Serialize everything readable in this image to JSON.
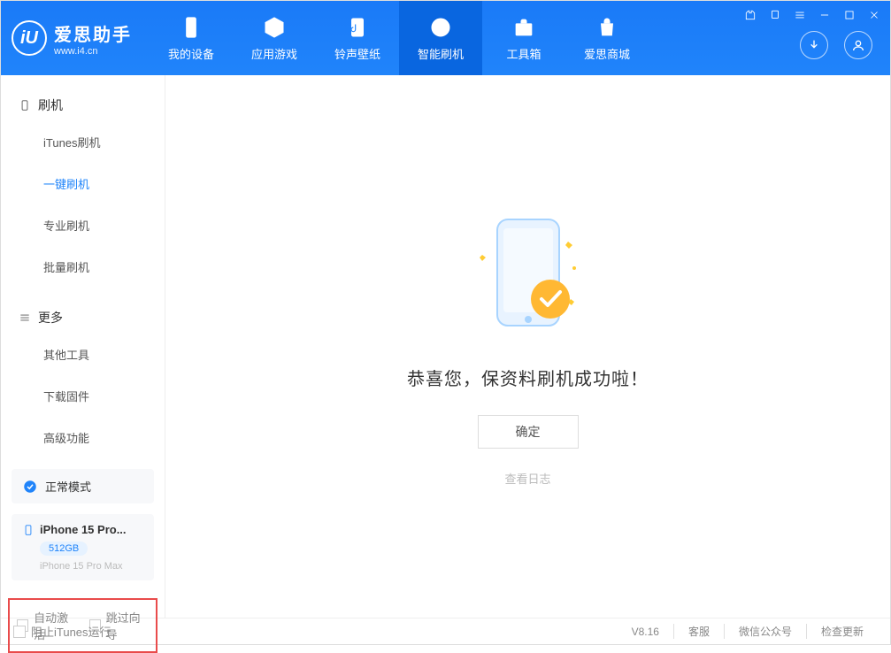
{
  "app": {
    "title": "爱思助手",
    "url": "www.i4.cn"
  },
  "nav": [
    {
      "label": "我的设备"
    },
    {
      "label": "应用游戏"
    },
    {
      "label": "铃声壁纸"
    },
    {
      "label": "智能刷机"
    },
    {
      "label": "工具箱"
    },
    {
      "label": "爱思商城"
    }
  ],
  "sidebar": {
    "sections": [
      {
        "title": "刷机",
        "items": [
          {
            "label": "iTunes刷机"
          },
          {
            "label": "一键刷机"
          },
          {
            "label": "专业刷机"
          },
          {
            "label": "批量刷机"
          }
        ]
      },
      {
        "title": "更多",
        "items": [
          {
            "label": "其他工具"
          },
          {
            "label": "下载固件"
          },
          {
            "label": "高级功能"
          }
        ]
      }
    ],
    "status": "正常模式",
    "device": {
      "name": "iPhone 15 Pro...",
      "storage": "512GB",
      "model": "iPhone 15 Pro Max"
    },
    "checkboxes": {
      "autoActivate": "自动激活",
      "skipWizard": "跳过向导"
    }
  },
  "content": {
    "successTitle": "恭喜您，保资料刷机成功啦！",
    "confirmButton": "确定",
    "viewLog": "查看日志"
  },
  "footer": {
    "blockItunes": "阻止iTunes运行",
    "version": "V8.16",
    "items": [
      "客服",
      "微信公众号",
      "检查更新"
    ]
  }
}
